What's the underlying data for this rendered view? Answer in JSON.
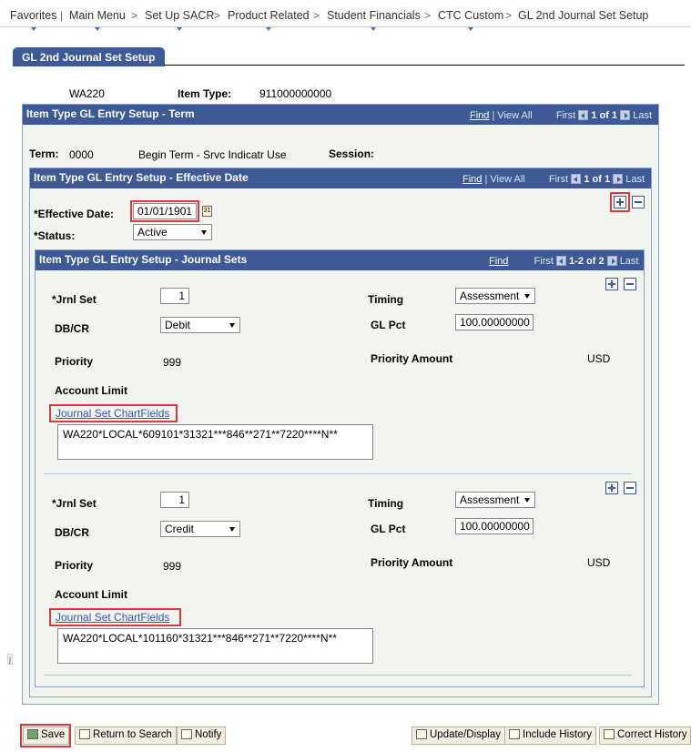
{
  "breadcrumb": {
    "items": [
      "Favorites",
      "Main Menu",
      "Set Up SACR",
      "Product Related",
      "Student Financials",
      "CTC Custom",
      "GL 2nd Journal Set Setup"
    ],
    "separator": ">"
  },
  "page_tab": "GL 2nd Journal Set Setup",
  "header": {
    "setid": "WA220",
    "item_type_label": "Item Type:",
    "item_type_value": "911000000000"
  },
  "term_grid": {
    "title": "Item Type GL Entry Setup - Term",
    "find": "Find",
    "view_all": "View All",
    "first": "First",
    "count": "1 of 1",
    "last": "Last",
    "term_label": "Term:",
    "term_value": "0000",
    "term_desc": "Begin Term - Srvc Indicatr Use",
    "session_label": "Session:"
  },
  "effdt_grid": {
    "title": "Item Type GL Entry Setup - Effective Date",
    "find": "Find",
    "view_all": "View All",
    "first": "First",
    "count": "1 of 1",
    "last": "Last",
    "effdt_label": "*Effective Date:",
    "effdt_value": "01/01/1901",
    "status_label": "*Status:",
    "status_value": "Active",
    "calendar_icon_text": "31"
  },
  "journal_grid": {
    "title": "Item Type GL Entry Setup - Journal Sets",
    "find": "Find",
    "first": "First",
    "count": "1-2 of 2",
    "last": "Last",
    "rows": [
      {
        "jrnl_set_label": "*Jrnl Set",
        "jrnl_set_value": "1",
        "timing_label": "Timing",
        "timing_value": "Assessment",
        "dbcr_label": "DB/CR",
        "dbcr_value": "Debit",
        "glpct_label": "GL Pct",
        "glpct_value": "100.00000000",
        "priority_label": "Priority",
        "priority_value": "999",
        "priority_amount_label": "Priority Amount",
        "currency": "USD",
        "account_limit_label": "Account Limit",
        "chartfields_link": "Journal Set ChartFields",
        "chartfields_value": "WA220*LOCAL*609101*31321***846**271**7220****N**"
      },
      {
        "jrnl_set_label": "*Jrnl Set",
        "jrnl_set_value": "1",
        "timing_label": "Timing",
        "timing_value": "Assessment",
        "dbcr_label": "DB/CR",
        "dbcr_value": "Credit",
        "glpct_label": "GL Pct",
        "glpct_value": "100.00000000",
        "priority_label": "Priority",
        "priority_value": "999",
        "priority_amount_label": "Priority Amount",
        "currency": "USD",
        "account_limit_label": "Account Limit",
        "chartfields_link": "Journal Set ChartFields",
        "chartfields_value": "WA220*LOCAL*101160*31321***846**271**7220****N**"
      }
    ]
  },
  "side_marker": "j",
  "toolbar": {
    "save": "Save",
    "return_to_search": "Return to Search",
    "notify": "Notify",
    "update_display": "Update/Display",
    "include_history": "Include History",
    "correct_history": "Correct History"
  },
  "colors": {
    "header_blue": "#3e5a96",
    "panel_bg": "#f1f4ef",
    "highlight_red": "#d9393f",
    "link_blue": "#2a5cb8"
  }
}
